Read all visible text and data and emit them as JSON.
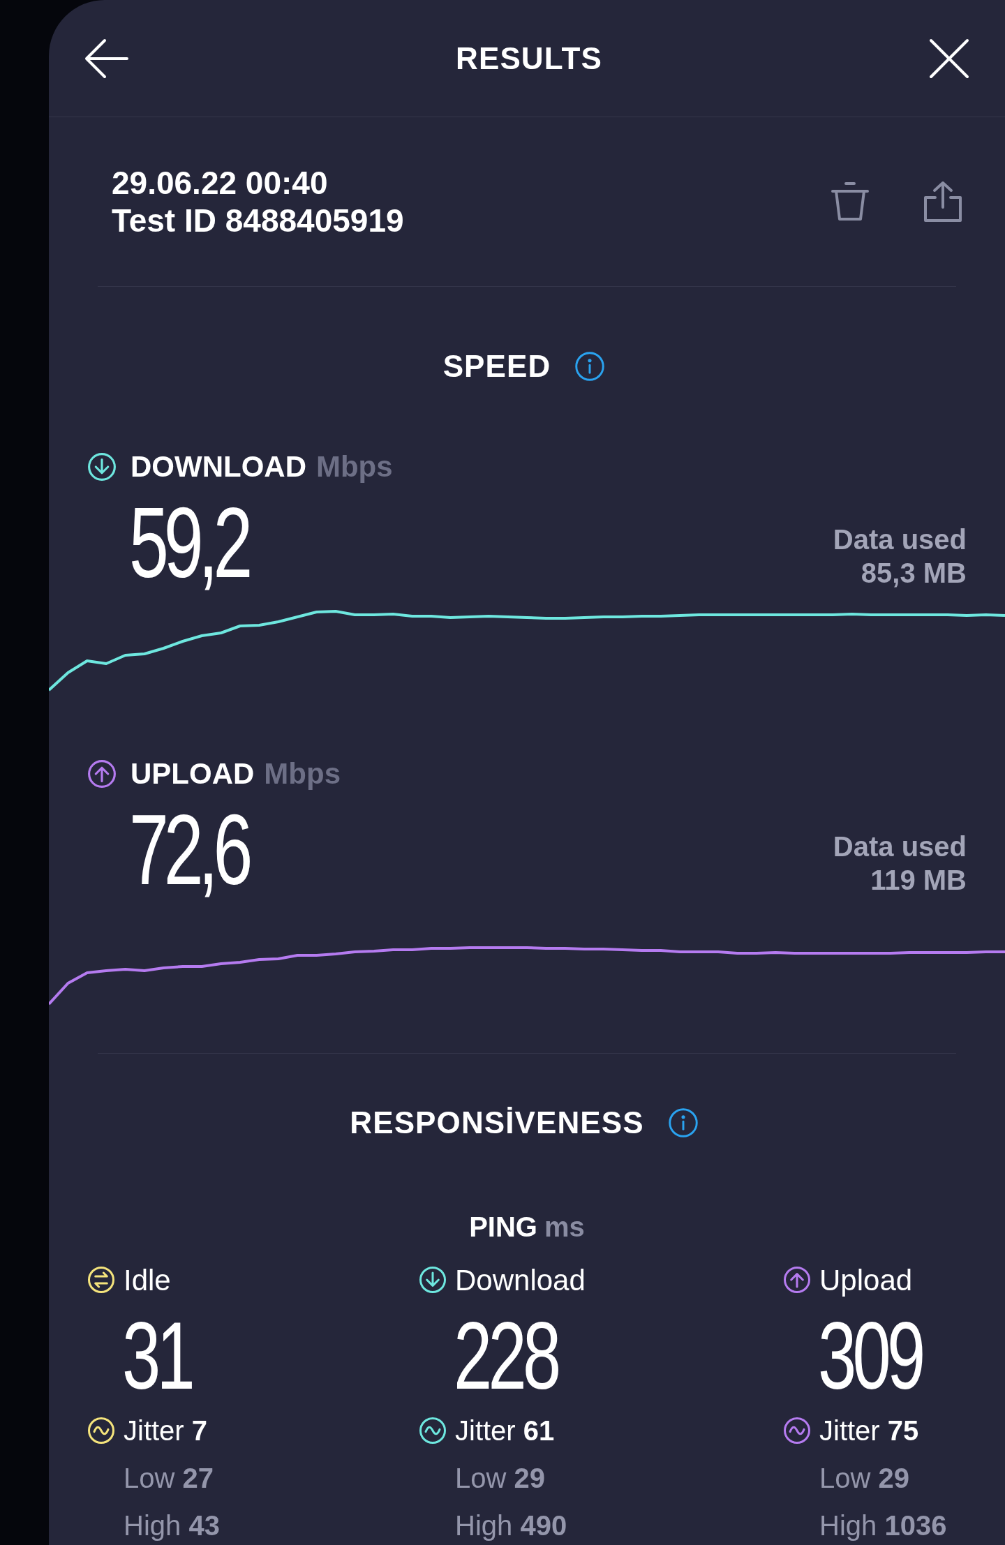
{
  "header": {
    "title": "RESULTS"
  },
  "test": {
    "date": "29.06.22 00:40",
    "id": "Test ID 8488405919"
  },
  "speed": {
    "title": "SPEED",
    "results": [
      {
        "kind": "download",
        "label": "DOWNLOAD",
        "unit": "Mbps",
        "value": "59,2",
        "data_label": "Data used",
        "data_value": "85,3 MB",
        "color": "#6ee7df"
      },
      {
        "kind": "upload",
        "label": "UPLOAD",
        "unit": "Mbps",
        "value": "72,6",
        "data_label": "Data used",
        "data_value": "119 MB",
        "color": "#b57bf0"
      }
    ]
  },
  "responsiveness": {
    "title": "RESPONSİVENESS",
    "ping_label": "PING",
    "ping_unit": "ms",
    "columns": [
      {
        "kind": "idle",
        "label": "Idle",
        "value": "31",
        "jitter_label": "Jitter",
        "jitter": "7",
        "low_label": "Low",
        "low": "27",
        "high_label": "High",
        "high": "43",
        "color": "#f5e47c"
      },
      {
        "kind": "download",
        "label": "Download",
        "value": "228",
        "jitter_label": "Jitter",
        "jitter": "61",
        "low_label": "Low",
        "low": "29",
        "high_label": "High",
        "high": "490",
        "color": "#6ee7df"
      },
      {
        "kind": "upload",
        "label": "Upload",
        "value": "309",
        "jitter_label": "Jitter",
        "jitter": "75",
        "low_label": "Low",
        "low": "29",
        "high_label": "High",
        "high": "1036",
        "color": "#b57bf0"
      }
    ]
  }
}
